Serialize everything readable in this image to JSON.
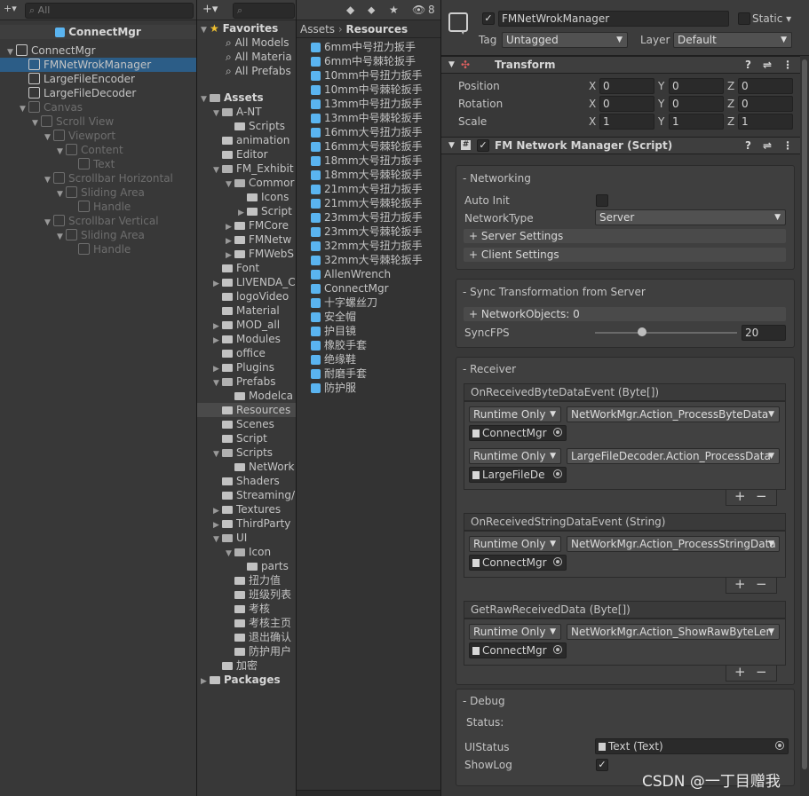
{
  "hierarchy": {
    "search_placeholder": "All",
    "scene_title": "ConnectMgr",
    "items": [
      {
        "label": "ConnectMgr"
      },
      {
        "label": "FMNetWrokManager"
      },
      {
        "label": "LargeFileEncoder"
      },
      {
        "label": "LargeFileDecoder"
      },
      {
        "label": "Canvas"
      },
      {
        "label": "Scroll View"
      },
      {
        "label": "Viewport"
      },
      {
        "label": "Content"
      },
      {
        "label": "Text"
      },
      {
        "label": "Scrollbar Horizontal"
      },
      {
        "label": "Sliding Area"
      },
      {
        "label": "Handle"
      },
      {
        "label": "Scrollbar Vertical"
      },
      {
        "label": "Sliding Area"
      },
      {
        "label": "Handle"
      }
    ]
  },
  "project": {
    "add_label": "+",
    "hidden_count": "8",
    "favorites": [
      "Favorites",
      "All Models",
      "All Materia",
      "All Prefabs"
    ],
    "tree": [
      "Assets",
      "A-NT",
      "Scripts",
      "animation",
      "Editor",
      "FM_Exhibit",
      "Commor",
      "Icons",
      "Script",
      "FMCore",
      "FMNetw",
      "FMWebS",
      "Font",
      "LIVENDA_C",
      "logoVideo",
      "Material",
      "MOD_all",
      "Modules",
      "office",
      "Plugins",
      "Prefabs",
      "Modelca",
      "Resources",
      "Scenes",
      "Script",
      "Scripts",
      "NetWork",
      "Shaders",
      "Streaming/",
      "Textures",
      "ThirdParty",
      "UI",
      "Icon",
      "parts",
      "扭力值",
      "班级列表",
      "考核",
      "考核主页",
      "退出确认",
      "防护用户",
      "加密",
      "Packages"
    ],
    "breadcrumb": [
      "Assets",
      "Resources"
    ],
    "files": [
      "6mm中号扭力扳手",
      "6mm中号棘轮扳手",
      "10mm中号扭力扳手",
      "10mm中号棘轮扳手",
      "13mm中号扭力扳手",
      "13mm中号棘轮扳手",
      "16mm大号扭力扳手",
      "16mm大号棘轮扳手",
      "18mm大号扭力扳手",
      "18mm大号棘轮扳手",
      "21mm大号扭力扳手",
      "21mm大号棘轮扳手",
      "23mm大号扭力扳手",
      "23mm大号棘轮扳手",
      "32mm大号扭力扳手",
      "32mm大号棘轮扳手",
      "AllenWrench",
      "ConnectMgr",
      "十字螺丝刀",
      "安全帽",
      "护目镜",
      "橡胶手套",
      "绝缘鞋",
      "耐磨手套",
      "防护服"
    ]
  },
  "inspector": {
    "object_name": "FMNetWrokManager",
    "static_label": "Static",
    "tag_label": "Tag",
    "tag_value": "Untagged",
    "layer_label": "Layer",
    "layer_value": "Default",
    "transform": {
      "title": "Transform",
      "rows": [
        {
          "label": "Position",
          "x": "0",
          "y": "0",
          "z": "0"
        },
        {
          "label": "Rotation",
          "x": "0",
          "y": "0",
          "z": "0"
        },
        {
          "label": "Scale",
          "x": "1",
          "y": "1",
          "z": "1"
        }
      ],
      "axis": [
        "X",
        "Y",
        "Z"
      ]
    },
    "script": {
      "title": "FM Network Manager (Script)",
      "networking_header": "- Networking",
      "auto_init_label": "Auto Init",
      "network_type_label": "NetworkType",
      "network_type_value": "Server",
      "server_settings": "+ Server Settings",
      "client_settings": "+ Client Settings",
      "sync_header": "- Sync Transformation from Server",
      "network_objects": "+ NetworkObjects: 0",
      "sync_fps_label": "SyncFPS",
      "sync_fps_value": "20",
      "sync_fps_fraction": 0.33,
      "receiver_header": "- Receiver",
      "events": [
        {
          "title": "OnReceivedByteDataEvent (Byte[])",
          "entries": [
            {
              "mode": "Runtime Only",
              "func": "NetWorkMgr.Action_ProcessByteData",
              "obj": "ConnectMgr"
            },
            {
              "mode": "Runtime Only",
              "func": "LargeFileDecoder.Action_ProcessData",
              "obj": "LargeFileDe"
            }
          ]
        },
        {
          "title": "OnReceivedStringDataEvent (String)",
          "entries": [
            {
              "mode": "Runtime Only",
              "func": "NetWorkMgr.Action_ProcessStringData",
              "obj": "ConnectMgr"
            }
          ]
        },
        {
          "title": "GetRawReceivedData (Byte[])",
          "entries": [
            {
              "mode": "Runtime Only",
              "func": "NetWorkMgr.Action_ShowRawByteLen",
              "obj": "ConnectMgr"
            }
          ]
        }
      ],
      "plus": "+",
      "minus": "−",
      "debug_header": "- Debug",
      "status_label": "Status:",
      "ui_status_label": "UIStatus",
      "ui_status_value": "Text (Text)",
      "show_log_label": "ShowLog",
      "show_log_checked": "✓"
    }
  },
  "watermark": "CSDN @一丁目赠我"
}
